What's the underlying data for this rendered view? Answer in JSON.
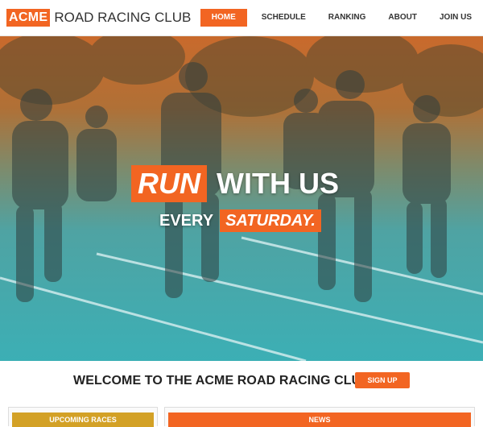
{
  "header": {
    "logo_acme": "ACME",
    "logo_rest": "ROAD RACING CLUB",
    "nav": [
      {
        "label": "HOME",
        "active": true
      },
      {
        "label": "SCHEDULE",
        "active": false
      },
      {
        "label": "RANKING",
        "active": false
      },
      {
        "label": "ABOUT",
        "active": false
      },
      {
        "label": "JOIN US",
        "active": false
      }
    ]
  },
  "hero": {
    "run": "RUN",
    "with_us": "WITH US",
    "every": "EVERY",
    "saturday": "SATURDAY."
  },
  "welcome": {
    "text": "WELCOME TO THE ACME ROAD RACING CLUB!",
    "signup": "SIGN UP"
  },
  "panels": {
    "upcoming": "UPCOMING RACES",
    "news": "NEWS"
  },
  "colors": {
    "accent": "#f26522",
    "gold": "#d3a126",
    "teal": "#3cafb5"
  }
}
